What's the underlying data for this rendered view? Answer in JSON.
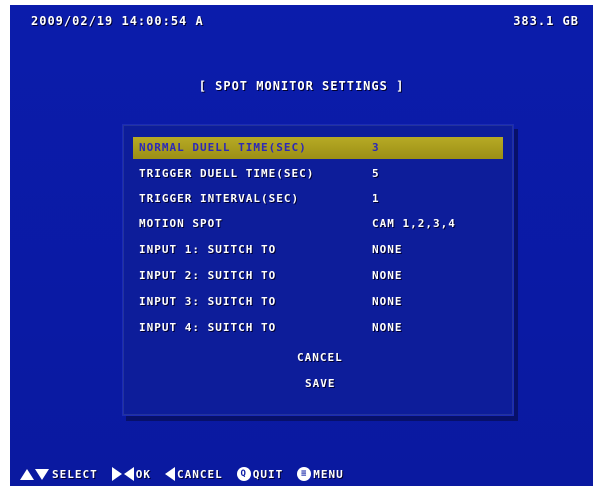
{
  "header": {
    "datetime": "2009/02/19 14:00:54  A",
    "storage": "383.1 GB"
  },
  "title": "[ SPOT MONITOR SETTINGS ]",
  "settings": [
    {
      "label": "NORMAL DUELL TIME(SEC)",
      "value": "3"
    },
    {
      "label": "TRIGGER DUELL TIME(SEC)",
      "value": "5"
    },
    {
      "label": "TRIGGER INTERVAL(SEC)",
      "value": "1"
    },
    {
      "label": "MOTION SPOT",
      "value": "CAM 1,2,3,4"
    },
    {
      "label": "INPUT 1: SUITCH TO",
      "value": "NONE"
    },
    {
      "label": "INPUT 2: SUITCH TO",
      "value": "NONE"
    },
    {
      "label": "INPUT 3: SUITCH TO",
      "value": "NONE"
    },
    {
      "label": "INPUT 4: SUITCH TO",
      "value": "NONE"
    }
  ],
  "buttons": {
    "cancel": "CANCEL",
    "save": "SAVE"
  },
  "footer": {
    "select": "SELECT",
    "ok": "OK",
    "cancel": "CANCEL",
    "quit": "QUIT",
    "menu": "MENU",
    "quit_icon_glyph": "Q",
    "menu_icon_glyph": "≡"
  },
  "colors": {
    "screen_bg": "#0a1aa3",
    "highlight": "#a89c1c",
    "text": "#ffffff"
  }
}
